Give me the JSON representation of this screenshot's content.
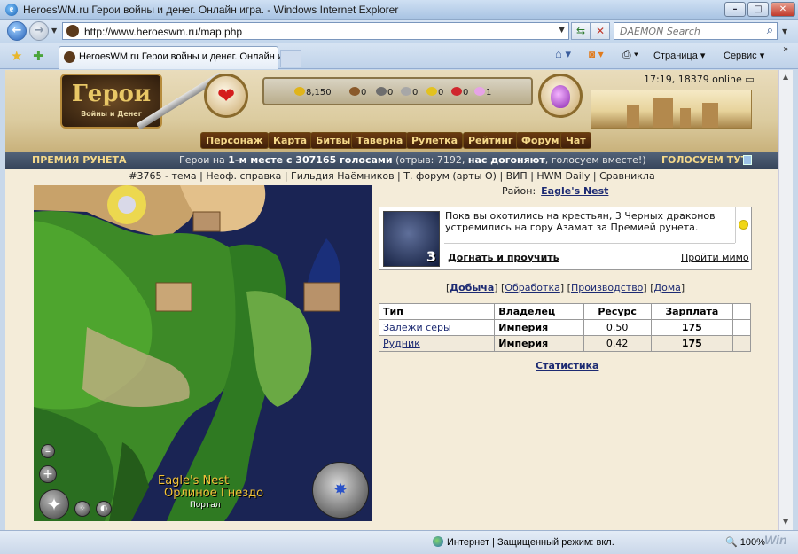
{
  "window": {
    "title": "HeroesWM.ru Герои войны и денег. Онлайн игра. - Windows Internet Explorer",
    "url": "http://www.heroeswm.ru/map.php",
    "search_placeholder": "DAEMON Search",
    "tab_title": "HeroesWM.ru Герои войны и денег. Онлайн иг...",
    "cmd_page": "Страница ▾",
    "cmd_tools": "Сервис ▾"
  },
  "header": {
    "logo_title": "Герои",
    "logo_sub": "Войны и Денег",
    "resources": [
      {
        "name": "gold",
        "value": "8,150",
        "color": "#e0b41a"
      },
      {
        "name": "wood",
        "value": "0",
        "color": "#8a5a2b"
      },
      {
        "name": "ore",
        "value": "0",
        "color": "#6e6e6e"
      },
      {
        "name": "mercury",
        "value": "0",
        "color": "#a7a7a7"
      },
      {
        "name": "sulfur",
        "value": "0",
        "color": "#e3c220"
      },
      {
        "name": "crystals",
        "value": "0",
        "color": "#d0262d"
      },
      {
        "name": "gems",
        "value": "1",
        "color": "#e6a3e6"
      }
    ],
    "clock": "17:19, 18379 online",
    "nav": [
      "Персонаж",
      "Карта",
      "Битвы",
      "Таверна",
      "Рулетка",
      "Рейтинг",
      "Форум",
      "Чат"
    ]
  },
  "strip": {
    "premia": "ПРЕМИЯ РУНЕТА",
    "vote_pre": "Герои на ",
    "vote_bold": "1-м месте с 307165 голосами",
    "vote_mid": " (отрыв: 7192, ",
    "vote_bold2": "нас догоняют",
    "vote_post": ", голосуем вместе!)",
    "vote_link": "ГОЛОСУЕМ ТУТ"
  },
  "links_row": "#3765 - тема | Неоф. справка | Гильдия Наёмников | Т. форум (арты О) | ВИП | HWM Daily | Сравникла",
  "map": {
    "name_en": "Eagle's Nest",
    "name_ru": "Орлиное Гнездо",
    "portal": "Портал"
  },
  "district": {
    "label": "Район:",
    "name": "Eagle's Nest"
  },
  "event": {
    "text": "Пока вы охотились на крестьян, 3 Черных драконов устремились на гору Азамат за Премией рунета.",
    "count": "3",
    "chase": "Догнать и проучить",
    "pass": "Пройти мимо"
  },
  "subnav": {
    "mining": "Добыча",
    "processing": "Обработка",
    "production": "Производство",
    "houses": "Дома"
  },
  "table": {
    "headers": [
      "Тип",
      "Владелец",
      "Ресурс",
      "Зарплата",
      ""
    ],
    "rows": [
      [
        "Залежи серы",
        "Империя",
        "0.50",
        "175",
        ""
      ],
      [
        "Рудник",
        "Империя",
        "0.42",
        "175",
        ""
      ]
    ]
  },
  "stats_link": "Статистика",
  "statusbar": {
    "zone": "Интернет | Защищенный режим: вкл.",
    "zoom": "100%"
  }
}
